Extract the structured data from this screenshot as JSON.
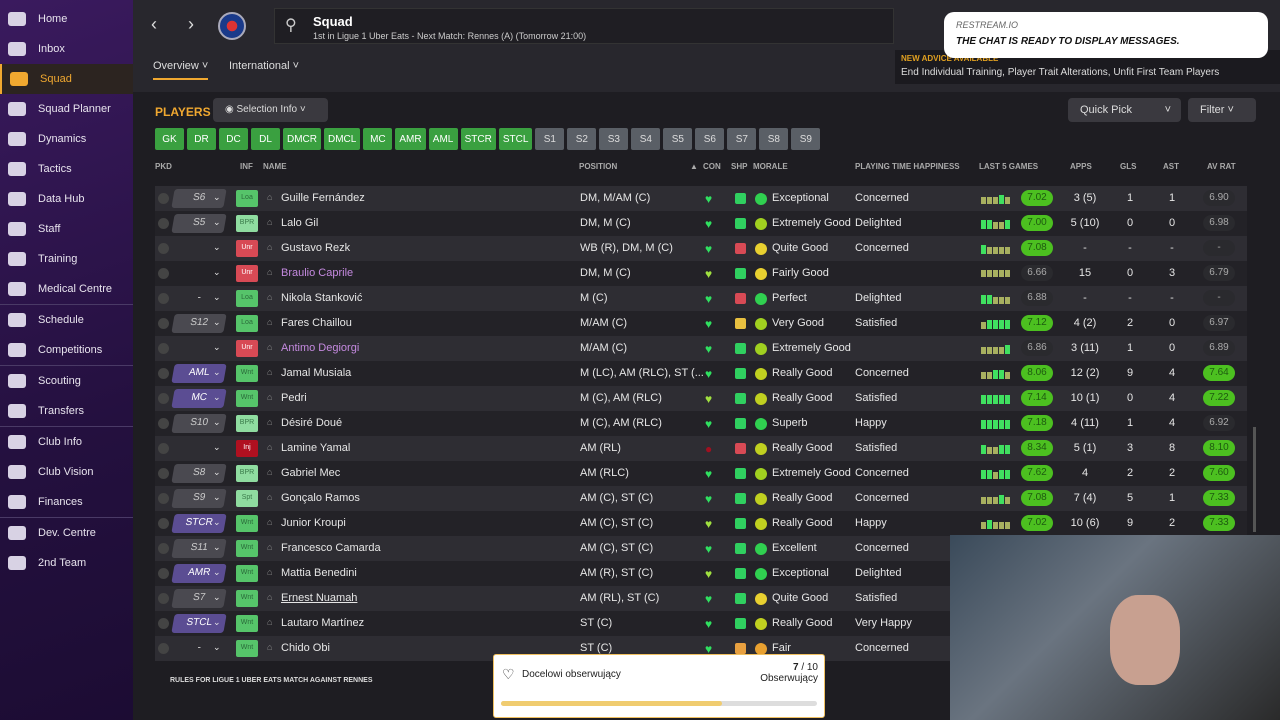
{
  "sidebar": {
    "items": [
      "Home",
      "Inbox",
      "Squad",
      "Squad Planner",
      "Dynamics",
      "Tactics",
      "Data Hub",
      "Staff",
      "Training",
      "Medical Centre",
      "Schedule",
      "Competitions",
      "Scouting",
      "Transfers",
      "Club Info",
      "Club Vision",
      "Finances",
      "Dev. Centre",
      "2nd Team"
    ],
    "active": "Squad"
  },
  "header": {
    "title": "Squad",
    "subtitle": "1st in Ligue 1 Uber Eats - Next Match: Rennes (A) (Tomorrow 21:00)",
    "tabs": [
      "Overview",
      "International"
    ]
  },
  "advice": {
    "heading": "NEW ADVICE AVAILABLE",
    "text": "End Individual Training, Player Trait Alterations, Unfit First Team Players"
  },
  "restream": {
    "author": "RESTREAM.IO",
    "message": "THE CHAT IS READY TO DISPLAY MESSAGES."
  },
  "toolbar": {
    "players": "PLAYERS",
    "selection_info": "Selection Info",
    "quick_pick": "Quick Pick",
    "filter": "Filter"
  },
  "positions": {
    "green": [
      "GK",
      "DR",
      "DC",
      "DL",
      "DMCR",
      "DMCL",
      "MC",
      "AMR",
      "AML",
      "STCR",
      "STCL"
    ],
    "grey": [
      "S1",
      "S2",
      "S3",
      "S4",
      "S5",
      "S6",
      "S7",
      "S8",
      "S9"
    ]
  },
  "columns": {
    "pkd": "PKD",
    "inf": "INF",
    "name": "NAME",
    "position": "POSITION",
    "con": "CON",
    "shp": "SHP",
    "morale": "MORALE",
    "pth": "PLAYING TIME HAPPINESS",
    "l5": "LAST 5 GAMES",
    "apps": "APPS",
    "gls": "GLS",
    "ast": "AST",
    "avrat": "AV RAT"
  },
  "colors": {
    "accent": "#f0a830",
    "green": "#4cc020",
    "purple": "#5b4d93"
  },
  "rows": [
    {
      "pkd": "S6",
      "inf": "Loa",
      "name": "Guille Fernández",
      "pos": "DM, M/AM (C)",
      "morale": "Exceptional",
      "pth": "Concerned",
      "last": "7.02",
      "lastG": true,
      "apps": "3 (5)",
      "gls": "1",
      "ast": "1",
      "av": "6.90",
      "avG": false
    },
    {
      "pkd": "S5",
      "inf": "BPR",
      "name": "Lalo Gil",
      "pos": "DM, M (C)",
      "morale": "Extremely Good",
      "pth": "Delighted",
      "last": "7.00",
      "lastG": true,
      "apps": "5 (10)",
      "gls": "0",
      "ast": "0",
      "av": "6.98",
      "avG": false
    },
    {
      "pkd": "",
      "inf": "Unr",
      "name": "Gustavo Rezk",
      "pos": "WB (R), DM, M (C)",
      "morale": "Quite Good",
      "pth": "Concerned",
      "last": "7.08",
      "lastG": true,
      "apps": "-",
      "gls": "-",
      "ast": "-",
      "av": "-",
      "avG": false
    },
    {
      "pkd": "",
      "inf": "Unr",
      "name": "Braulio Caprile",
      "purple": true,
      "pos": "DM, M (C)",
      "morale": "Fairly Good",
      "pth": "",
      "last": "6.66",
      "lastG": false,
      "apps": "15",
      "gls": "0",
      "ast": "3",
      "av": "6.79",
      "avG": false
    },
    {
      "pkd": "-",
      "inf": "Loa",
      "name": "Nikola Stanković",
      "pos": "M (C)",
      "morale": "Perfect",
      "pth": "Delighted",
      "last": "6.88",
      "lastG": false,
      "apps": "-",
      "gls": "-",
      "ast": "-",
      "av": "-",
      "avG": false
    },
    {
      "pkd": "S12",
      "inf": "Loa",
      "name": "Fares Chaillou",
      "pos": "M/AM (C)",
      "morale": "Very Good",
      "pth": "Satisfied",
      "last": "7.12",
      "lastG": true,
      "apps": "4 (2)",
      "gls": "2",
      "ast": "0",
      "av": "6.97",
      "avG": false
    },
    {
      "pkd": "",
      "inf": "Unr",
      "name": "Antimo Degiorgi",
      "purple": true,
      "pos": "M/AM (C)",
      "morale": "Extremely Good",
      "pth": "",
      "last": "6.86",
      "lastG": false,
      "apps": "3 (11)",
      "gls": "1",
      "ast": "0",
      "av": "6.89",
      "avG": false
    },
    {
      "pkd": "AML",
      "inf": "Wnt",
      "name": "Jamal Musiala",
      "pos": "M (LC), AM (RLC), ST (...",
      "morale": "Really Good",
      "pth": "Concerned",
      "last": "8.06",
      "lastG": true,
      "apps": "12 (2)",
      "gls": "9",
      "ast": "4",
      "av": "7.64",
      "avG": true
    },
    {
      "pkd": "MC",
      "inf": "Wnt",
      "name": "Pedri",
      "pos": "M (C), AM (RLC)",
      "morale": "Really Good",
      "pth": "Satisfied",
      "last": "7.14",
      "lastG": true,
      "apps": "10 (1)",
      "gls": "0",
      "ast": "4",
      "av": "7.22",
      "avG": true
    },
    {
      "pkd": "S10",
      "inf": "BPR",
      "name": "Désiré Doué",
      "pos": "M (C), AM (RLC)",
      "morale": "Superb",
      "pth": "Happy",
      "last": "7.18",
      "lastG": true,
      "apps": "4 (11)",
      "gls": "1",
      "ast": "4",
      "av": "6.92",
      "avG": false
    },
    {
      "pkd": "",
      "inf": "Inj",
      "name": "Lamine Yamal",
      "pos": "AM (RL)",
      "morale": "Really Good",
      "pth": "Satisfied",
      "last": "8.34",
      "lastG": true,
      "apps": "5 (1)",
      "gls": "3",
      "ast": "8",
      "av": "8.10",
      "avG": true
    },
    {
      "pkd": "S8",
      "inf": "BPR",
      "name": "Gabriel Mec",
      "pos": "AM (RLC)",
      "morale": "Extremely Good",
      "pth": "Concerned",
      "last": "7.62",
      "lastG": true,
      "apps": "4",
      "gls": "2",
      "ast": "2",
      "av": "7.60",
      "avG": true
    },
    {
      "pkd": "S9",
      "inf": "Spt",
      "name": "Gonçalo Ramos",
      "pos": "AM (C), ST (C)",
      "morale": "Really Good",
      "pth": "Concerned",
      "last": "7.08",
      "lastG": true,
      "apps": "7 (4)",
      "gls": "5",
      "ast": "1",
      "av": "7.33",
      "avG": true
    },
    {
      "pkd": "STCR",
      "inf": "Wnt",
      "name": "Junior Kroupi",
      "pos": "AM (C), ST (C)",
      "morale": "Really Good",
      "pth": "Happy",
      "last": "7.02",
      "lastG": true,
      "apps": "10 (6)",
      "gls": "9",
      "ast": "2",
      "av": "7.33",
      "avG": true
    },
    {
      "pkd": "S11",
      "inf": "Wnt",
      "name": "Francesco Camarda",
      "pos": "AM (C), ST (C)",
      "morale": "Excellent",
      "pth": "Concerned"
    },
    {
      "pkd": "AMR",
      "inf": "Wnt",
      "name": "Mattia Benedini",
      "pos": "AM (R), ST (C)",
      "morale": "Exceptional",
      "pth": "Delighted"
    },
    {
      "pkd": "S7",
      "inf": "Wnt",
      "name": "Ernest Nuamah",
      "underline": true,
      "pos": "AM (RL), ST (C)",
      "morale": "Quite Good",
      "pth": "Satisfied"
    },
    {
      "pkd": "STCL",
      "inf": "Wnt",
      "name": "Lautaro Martínez",
      "pos": "ST (C)",
      "morale": "Really Good",
      "pth": "Very Happy"
    },
    {
      "pkd": "-",
      "inf": "Wnt",
      "name": "Chido Obi",
      "pos": "ST (C)",
      "morale": "Fair",
      "pth": "Concerned"
    }
  ],
  "rules_text": "RULES FOR LIGUE 1 UBER EATS MATCH AGAINST RENNES",
  "popup": {
    "title": "Docelowi obserwujący",
    "current": "7",
    "total": "/ 10",
    "label": "Obserwujący",
    "progress": 0.7
  }
}
